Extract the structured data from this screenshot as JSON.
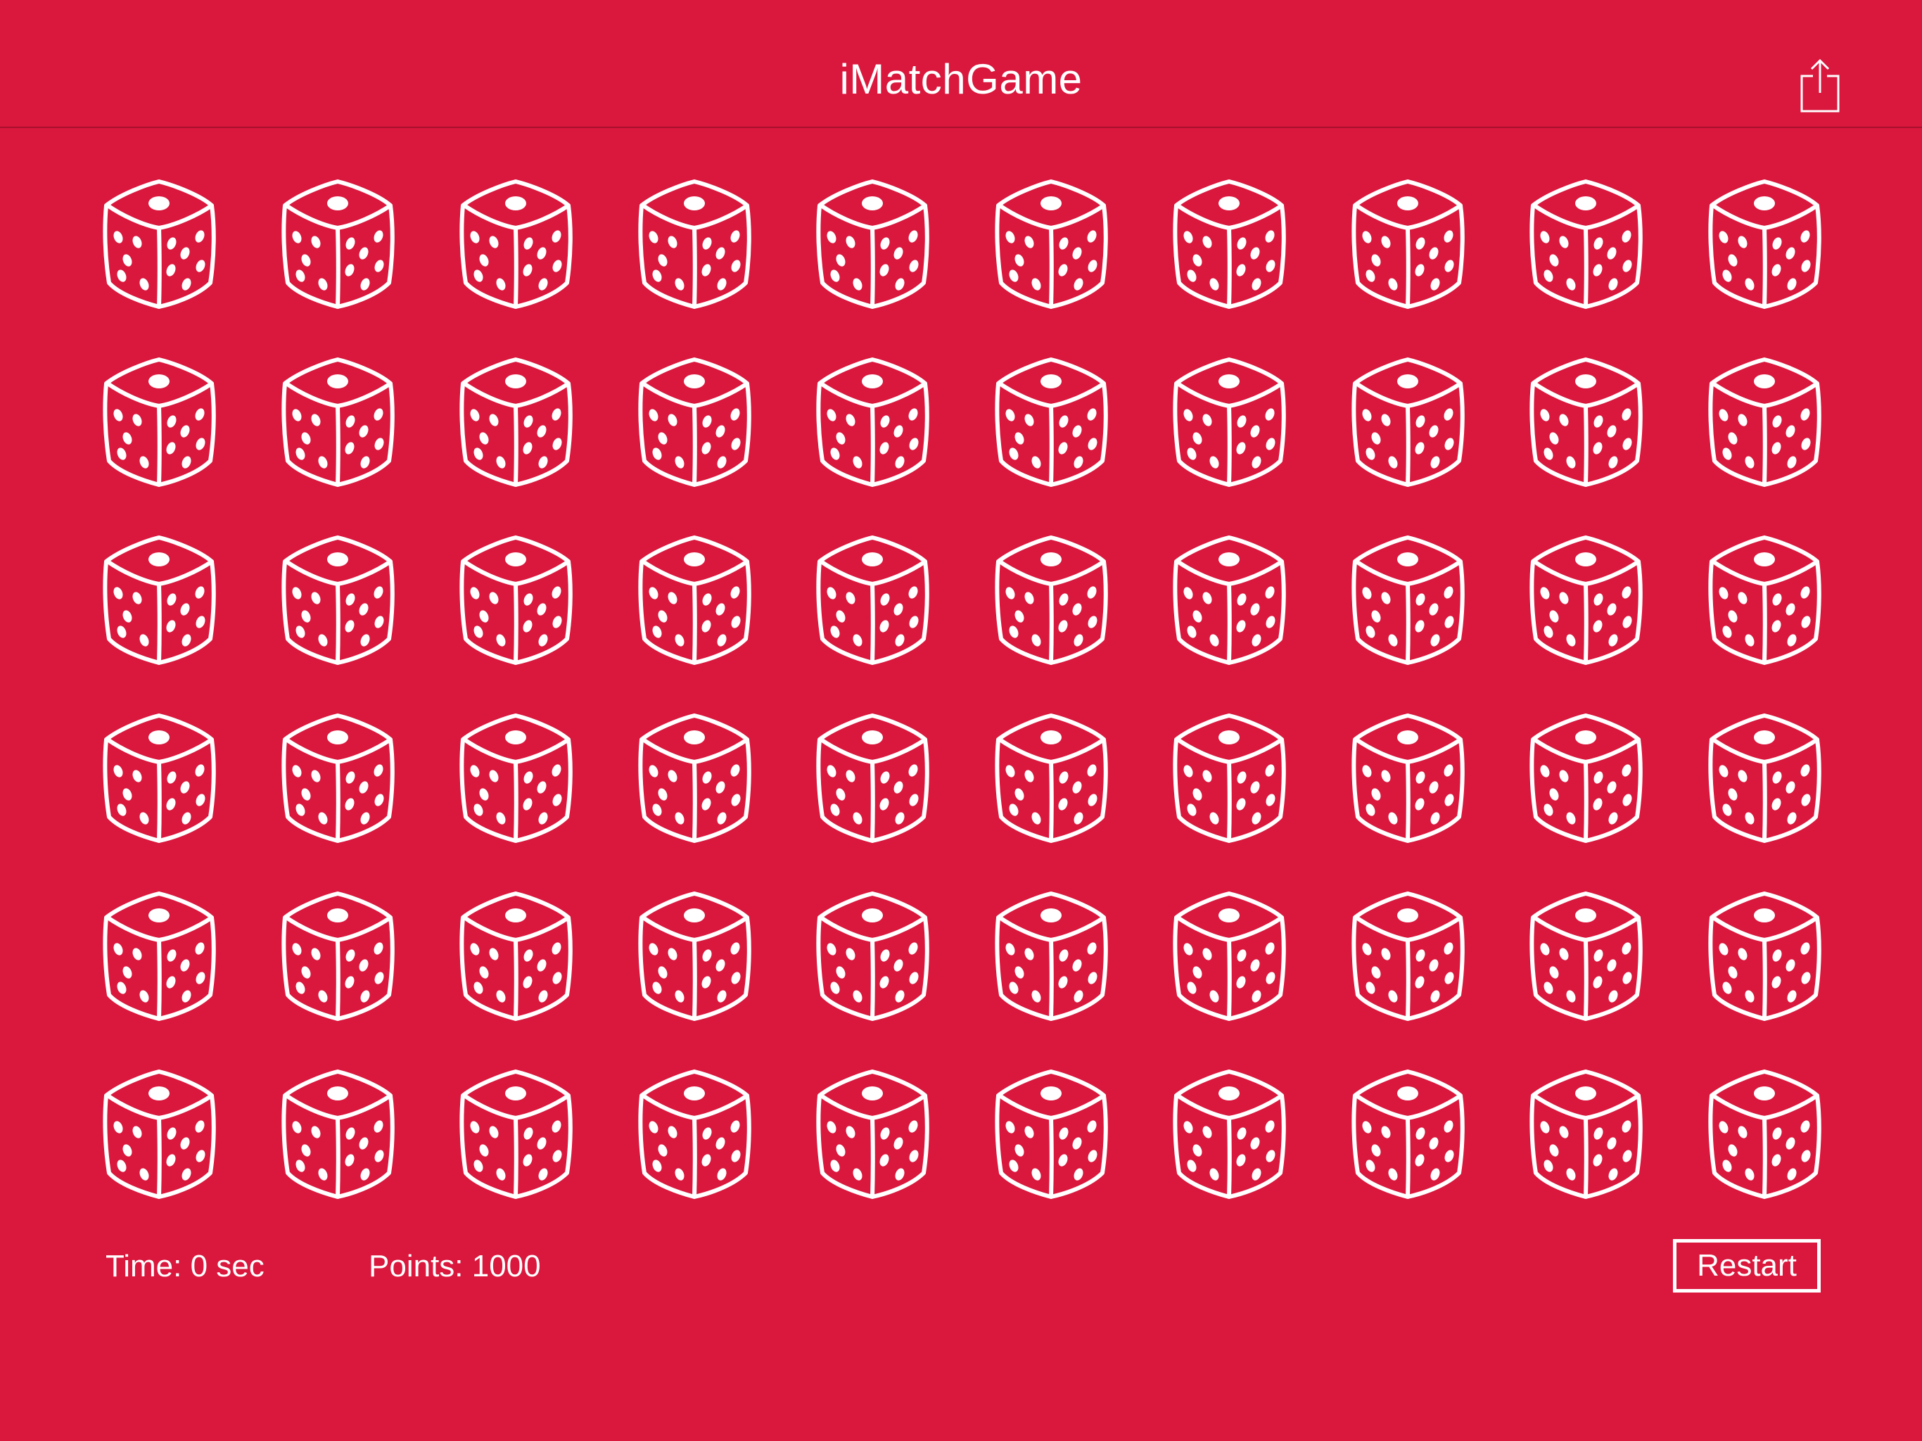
{
  "app": {
    "title": "iMatchGame",
    "accent_color": "#DA173D",
    "foreground_color": "#FFFFFF"
  },
  "navbar": {
    "share_icon": "share-icon"
  },
  "board": {
    "rows": 6,
    "columns": 10,
    "card_back_icon": "dice-icon"
  },
  "status": {
    "time_text": "Time: 0 sec",
    "points_text": "Points: 1000"
  },
  "controls": {
    "restart_label": "Restart"
  }
}
